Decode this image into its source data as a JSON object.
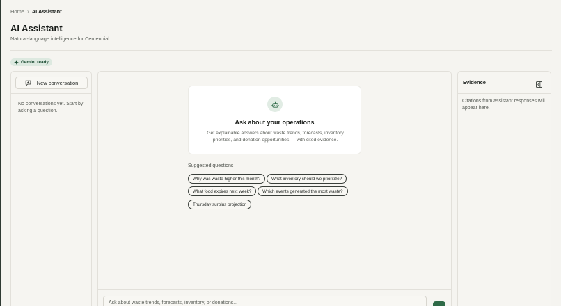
{
  "breadcrumb": {
    "home": "Home",
    "separator": "›",
    "current": "AI Assistant"
  },
  "header": {
    "title": "AI Assistant",
    "subtitle": "Natural-language intelligence for Centennial"
  },
  "status": {
    "label": "Gemini ready",
    "icon": "sparkle-icon"
  },
  "sidebar": {
    "new_conversation_label": "New conversation",
    "new_conversation_icon": "chat-plus-icon",
    "empty_text": "No conversations yet. Start by asking a question."
  },
  "main": {
    "bot_icon": "robot-icon",
    "welcome_title": "Ask about your operations",
    "welcome_description": "Get explainable answers about waste trends, forecasts, inventory priorities, and donation opportunities — with cited evidence.",
    "suggested_label": "Suggested questions",
    "suggestions": [
      "Why was waste higher this month?",
      "What inventory should we prioritize?",
      "What food expires next week?",
      "Which events generated the most waste?",
      "Thursday surplus projection"
    ],
    "composer_placeholder": "Ask about waste trends, forecasts, inventory, or donations..."
  },
  "evidence": {
    "title": "Evidence",
    "collapse_icon": "panel-collapse-icon",
    "empty_text": "Citations from assistant responses will appear here."
  },
  "colors": {
    "accent": "#2e6a47",
    "badge_bg": "#dde9e0",
    "page_bg": "#f5f4f0"
  }
}
